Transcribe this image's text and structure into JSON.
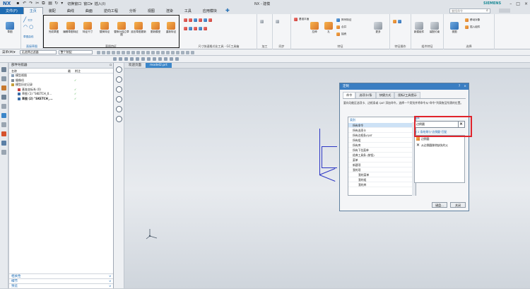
{
  "app": {
    "logo": "NX",
    "quick_access_text": "切换窗口",
    "quick_access_window": "窗口▾",
    "insert_text": "插入(I)",
    "title": "NX - 建模",
    "brand": "SIEMENS"
  },
  "tabs": {
    "file": "文件(F)",
    "items": [
      "主页",
      "装配",
      "曲线",
      "曲面",
      "逆向工程",
      "分析",
      "视图",
      "渲染",
      "工具",
      "应用模块"
    ],
    "active": "主页",
    "search_placeholder": "查找命令"
  },
  "ribbon": {
    "sketch_group": {
      "label": "直接草图",
      "sketch_btn": "草图",
      "group2": "草图曲线"
    },
    "constraint_group": {
      "label": "草图特征",
      "buttons": [
        "完成草图",
        "编辑草图特征",
        "特征尺寸",
        "替换特征",
        "替换为独立草图",
        "延迟草图更新",
        "更新模型",
        "重新特征"
      ]
    },
    "dim_group_label": "尺寸快速格式化工具 - GC工具箱",
    "machining_label": "加工",
    "synchronous_label": "同步",
    "feature_group": {
      "label": "特征",
      "buttons": [
        "基准平面",
        "拉伸",
        "孔",
        "阵列特征",
        "合并",
        "抽壳",
        "更多"
      ]
    },
    "feature_ops_label": "特征操作",
    "assembly_label": "组件特征",
    "assembly_buttons": [
      "新建组件",
      "装配约束"
    ],
    "right_buttons": [
      "移动对象",
      "插入组件"
    ],
    "select_label": "选择",
    "view_label": "视图"
  },
  "toolbar": {
    "menu": "菜单(M)▾",
    "filter": "无选择过滤器",
    "scope": "整个装配"
  },
  "navigator": {
    "title": "部件导航器",
    "cols": [
      "名称",
      "最",
      "附注"
    ],
    "rows": [
      {
        "text": "模型视图",
        "check": ""
      },
      {
        "text": "摄像机",
        "check": "✓"
      },
      {
        "text": "模型历史记录",
        "check": ""
      },
      {
        "text": "基准坐标系 (0)",
        "check": "✓"
      },
      {
        "text": "草图 (1) \"SKETCH_0...",
        "check": "✓"
      },
      {
        "text": "草图 (2) \"SKETCH_...",
        "check": "✓"
      }
    ],
    "bottom": [
      "相关性",
      "细节",
      "预览"
    ]
  },
  "doctabs": [
    "欢迎页面",
    "model2.prt"
  ],
  "dialog": {
    "title": "定制",
    "tabs": [
      "命令",
      "选项卡/条",
      "快捷方式",
      "图标/工具提示"
    ],
    "desc": "要向功能区选项卡、边框条或 QAT 添加命令，选择一个类别并将命令从\"命令\"列表拖至所需的位置。",
    "category_label": "类别",
    "categories": [
      {
        "text": "所有命令",
        "sel": true,
        "child": false
      },
      {
        "text": "所有选项卡",
        "sel": false,
        "child": false
      },
      {
        "text": "所有边框条/QAT",
        "sel": false,
        "child": false
      },
      {
        "text": "所有组",
        "sel": false,
        "child": false
      },
      {
        "text": "所有库",
        "sel": false,
        "child": false
      },
      {
        "text": "所有下拉菜单",
        "sel": false,
        "child": false
      },
      {
        "text": "经典工具条 (按钮)",
        "sel": false,
        "child": false
      },
      {
        "text": "菜单",
        "sel": false,
        "child": false
      },
      {
        "text": "新建项",
        "sel": false,
        "child": false
      },
      {
        "text": "我的项",
        "sel": false,
        "child": false
      },
      {
        "text": "我的菜单",
        "sel": false,
        "child": true
      },
      {
        "text": "我的组",
        "sel": false,
        "child": true
      },
      {
        "text": "我的库",
        "sel": false,
        "child": true
      }
    ],
    "search_label": "搜索",
    "search_value": "边倒圆",
    "result_count": "有 2 条结果与\"边倒圆\"匹配",
    "results": [
      "边倒圆",
      "从边倒圆移除缺失的父"
    ],
    "footer": [
      "键盘...",
      "关闭"
    ]
  },
  "colors": {
    "accent": "#1f6cb3",
    "highlight": "#e0242c",
    "axis": "#2b35c4"
  }
}
